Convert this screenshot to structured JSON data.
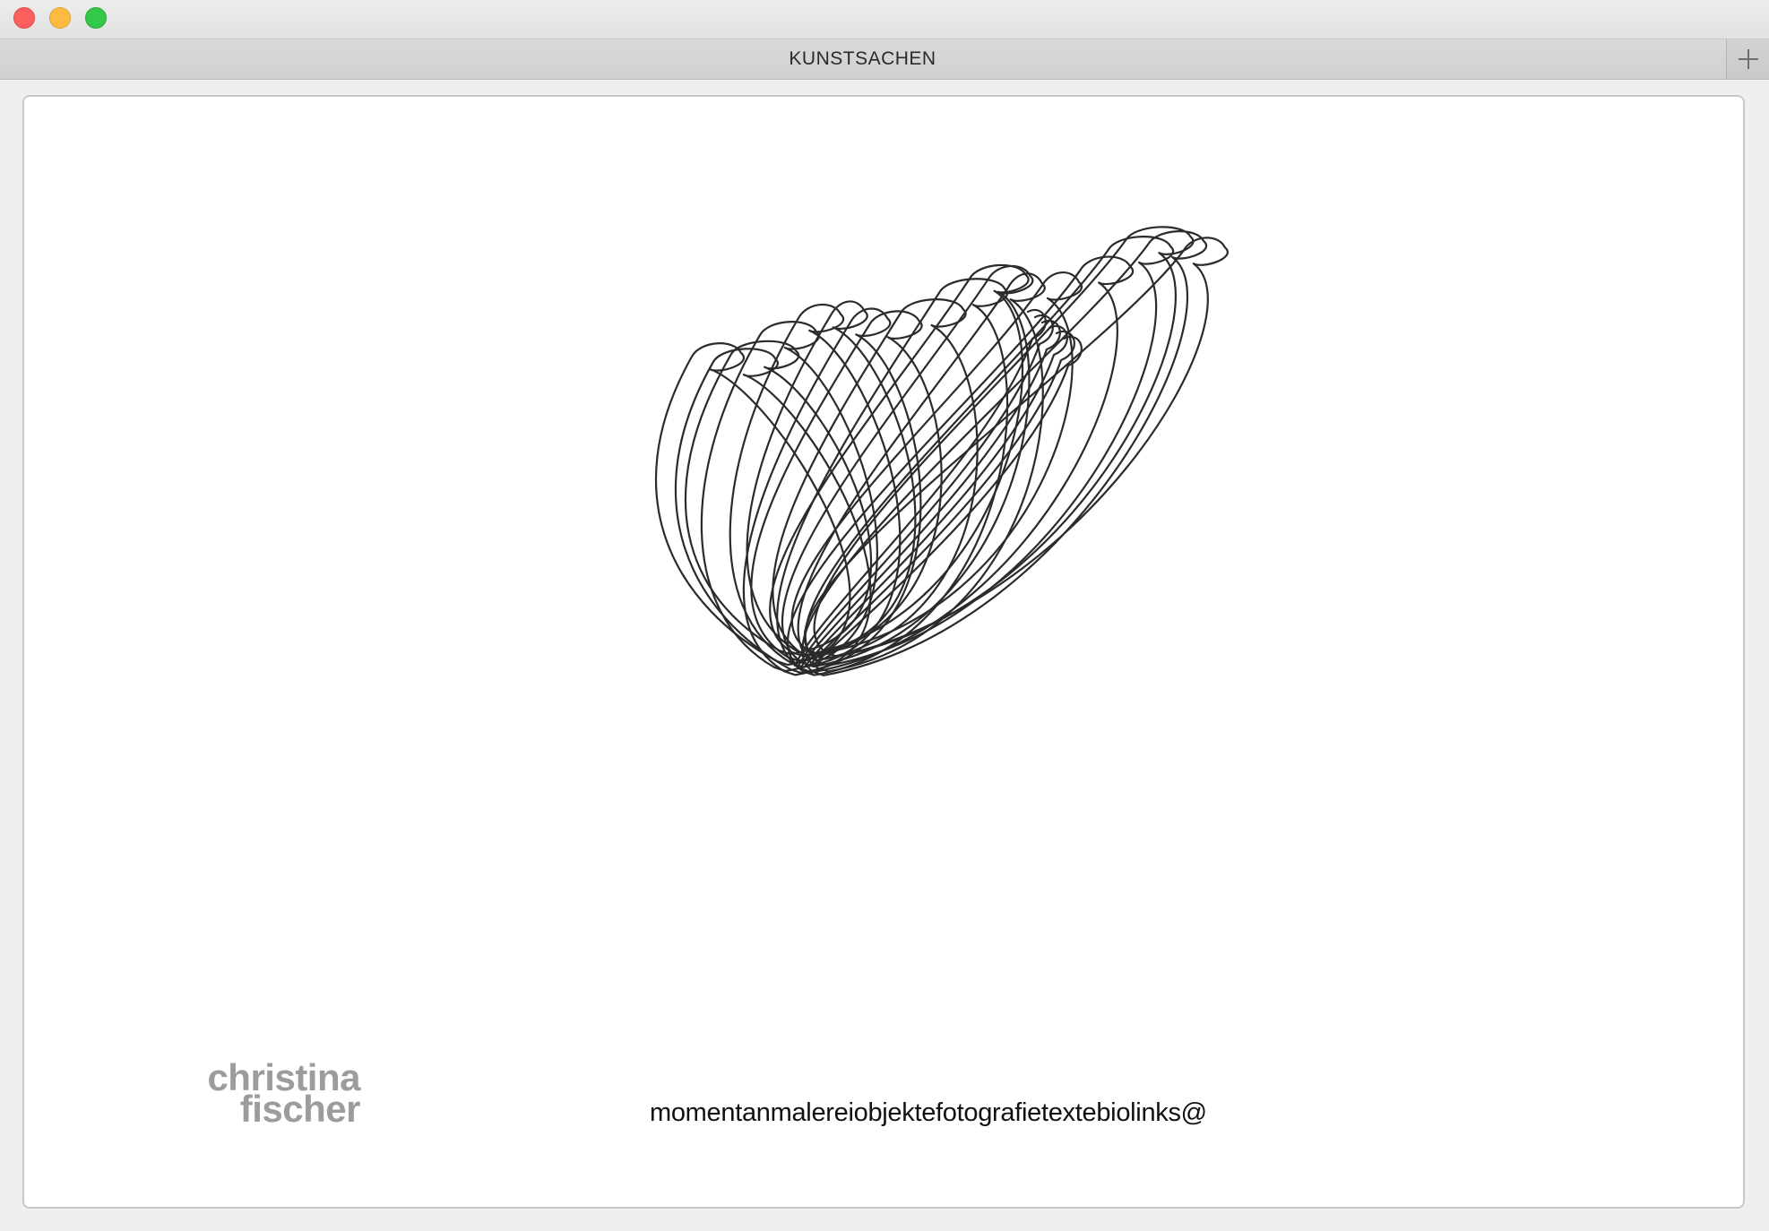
{
  "window": {
    "tab_title": "KUNSTSACHEN"
  },
  "icons": {
    "close": "red-close-circle",
    "minimize": "yellow-minimize-circle",
    "maximize": "green-maximize-circle",
    "new_tab": "plus-icon"
  },
  "colors": {
    "close": "#fc605c",
    "minimize": "#fdbc40",
    "maximize": "#34c84a",
    "logo_text": "#9c9c9c",
    "nav_text": "#111111",
    "drawing_stroke": "#2b2b2b"
  },
  "logo": {
    "line1": "christina",
    "line2": "fischer"
  },
  "nav": {
    "items": [
      {
        "label": "momentan"
      },
      {
        "label": "malerei"
      },
      {
        "label": "objekte"
      },
      {
        "label": "fotografie"
      },
      {
        "label": "texte"
      },
      {
        "label": "bio"
      },
      {
        "label": "links"
      },
      {
        "label": "@"
      }
    ]
  }
}
